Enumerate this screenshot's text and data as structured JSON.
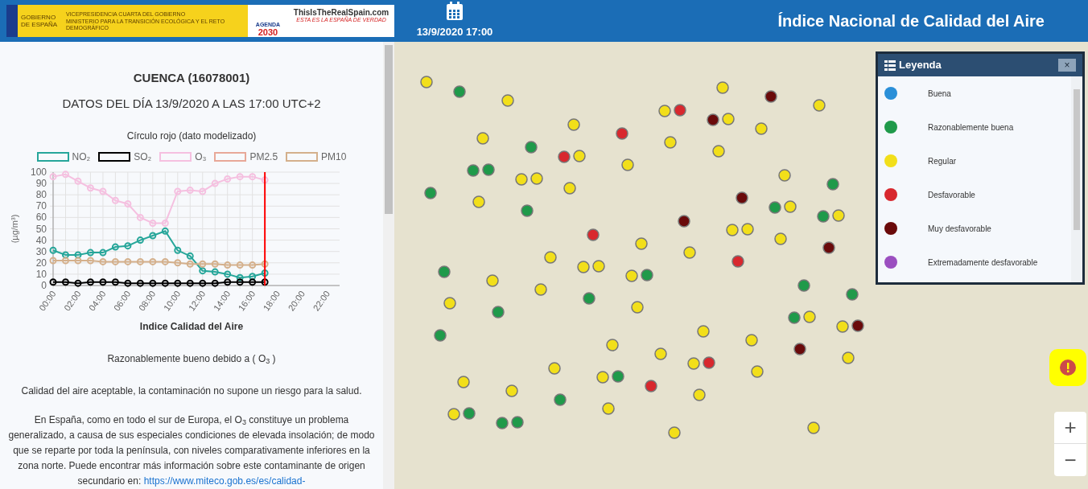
{
  "header": {
    "logo_gobierno": "GOBIERNO DE ESPAÑA",
    "logo_ministerio_1": "VICEPRESIDENCIA CUARTA DEL GOBIERNO",
    "logo_ministerio_2": "MINISTERIO PARA LA TRANSICIÓN ECOLÓGICA Y EL RETO DEMOGRÁFICO",
    "logo_agenda": "AGENDA",
    "logo_agenda_year": "2030",
    "logo_spain": "ThisIsTheRealSpain.com",
    "logo_spain_tagline": "ESTA ES LA ESPAÑA DE VERDAD",
    "date": "13/9/2020 17:00",
    "title": "Índice Nacional de Calidad del Aire"
  },
  "station": {
    "name": "CUENCA (16078001)",
    "date_line": "DATOS DEL DÍA 13/9/2020 A LAS 17:00 UTC+2",
    "note": "Círculo rojo (dato modelizado)",
    "chart_data": {
      "type": "line",
      "ylabel": "(µg/m³)",
      "x": [
        0,
        1,
        2,
        3,
        4,
        5,
        6,
        7,
        8,
        9,
        10,
        11,
        12,
        13,
        14,
        15,
        16,
        17
      ],
      "xlim": [
        0,
        23
      ],
      "ylim": [
        0,
        100
      ],
      "yticks": [
        0,
        10,
        20,
        30,
        40,
        50,
        60,
        70,
        80,
        90,
        100
      ],
      "xticks": [
        {
          "value": 0,
          "label": "00:00"
        },
        {
          "value": 2,
          "label": "02:00"
        },
        {
          "value": 4,
          "label": "04:00"
        },
        {
          "value": 6,
          "label": "06:00"
        },
        {
          "value": 8,
          "label": "08:00"
        },
        {
          "value": 10,
          "label": "10:00"
        },
        {
          "value": 12,
          "label": "12:00"
        },
        {
          "value": 14,
          "label": "14:00"
        },
        {
          "value": 16,
          "label": "16:00"
        },
        {
          "value": 18,
          "label": "18:00"
        },
        {
          "value": 20,
          "label": "20:00"
        },
        {
          "value": 22,
          "label": "22:00"
        }
      ],
      "grid": true,
      "series": [
        {
          "name": "NO₂",
          "color": "#26a69a",
          "marker": "circle",
          "values": [
            31,
            27,
            27,
            29,
            29,
            34,
            35,
            40,
            44,
            48,
            31,
            26,
            13,
            12,
            10,
            7,
            8,
            11
          ]
        },
        {
          "name": "SO₂",
          "color": "#000000",
          "marker": "circle",
          "values": [
            3,
            3,
            2,
            3,
            3,
            3,
            2,
            2,
            2,
            2,
            2,
            2,
            2,
            2,
            3,
            3,
            3,
            3
          ]
        },
        {
          "name": "O₃",
          "color": "#f5c0e0",
          "marker": "circle",
          "values": [
            96,
            98,
            92,
            86,
            83,
            75,
            72,
            60,
            55,
            55,
            83,
            84,
            83,
            90,
            94,
            96,
            96,
            93
          ]
        },
        {
          "name": "PM2.5",
          "color": "#e8a898",
          "values": [
            null,
            null,
            null,
            null,
            null,
            null,
            null,
            null,
            null,
            null,
            null,
            null,
            null,
            null,
            null,
            null,
            null,
            null
          ]
        },
        {
          "name": "PM10",
          "color": "#d4b08c",
          "marker": "circle",
          "values": [
            22,
            22,
            22,
            22,
            21,
            21,
            21,
            21,
            21,
            21,
            20,
            19,
            19,
            19,
            18,
            18,
            18,
            19
          ]
        }
      ],
      "ref_lines": [
        {
          "axis": "x",
          "value": 17,
          "color": "#ff0000"
        }
      ]
    },
    "index_title": "Indice Calidad del Aire",
    "index_value": "Razonablemente bueno debido a ( O$_{3}$ )",
    "summary": "Calidad del aire aceptable, la contaminación no supone un riesgo para la salud.",
    "description": "En España, como en todo el sur de Europa, el O$_{3}$ constituye un problema generalizado, a causa de sus especiales condiciones de elevada insolación; de modo que se reparte por toda la península, con niveles comparativamente inferiores en la zona norte. Puede encontrar más información sobre este contaminante de origen secundario en:",
    "link": "https://www.miteco.gob.es/es/calidad-"
  },
  "legend": {
    "title": "Leyenda",
    "close": "×",
    "items": [
      {
        "label": "Buena",
        "color": "#2a8fd8"
      },
      {
        "label": "Razonablemente buena",
        "color": "#1f9a4a"
      },
      {
        "label": "Regular",
        "color": "#f2df1a"
      },
      {
        "label": "Desfavorable",
        "color": "#d8282e"
      },
      {
        "label": "Muy desfavorable",
        "color": "#6a0a0a"
      },
      {
        "label": "Extremadamente desfavorable",
        "color": "#9b4fc0"
      }
    ]
  },
  "map_controls": {
    "zoom_in": "+",
    "zoom_out": "−"
  }
}
